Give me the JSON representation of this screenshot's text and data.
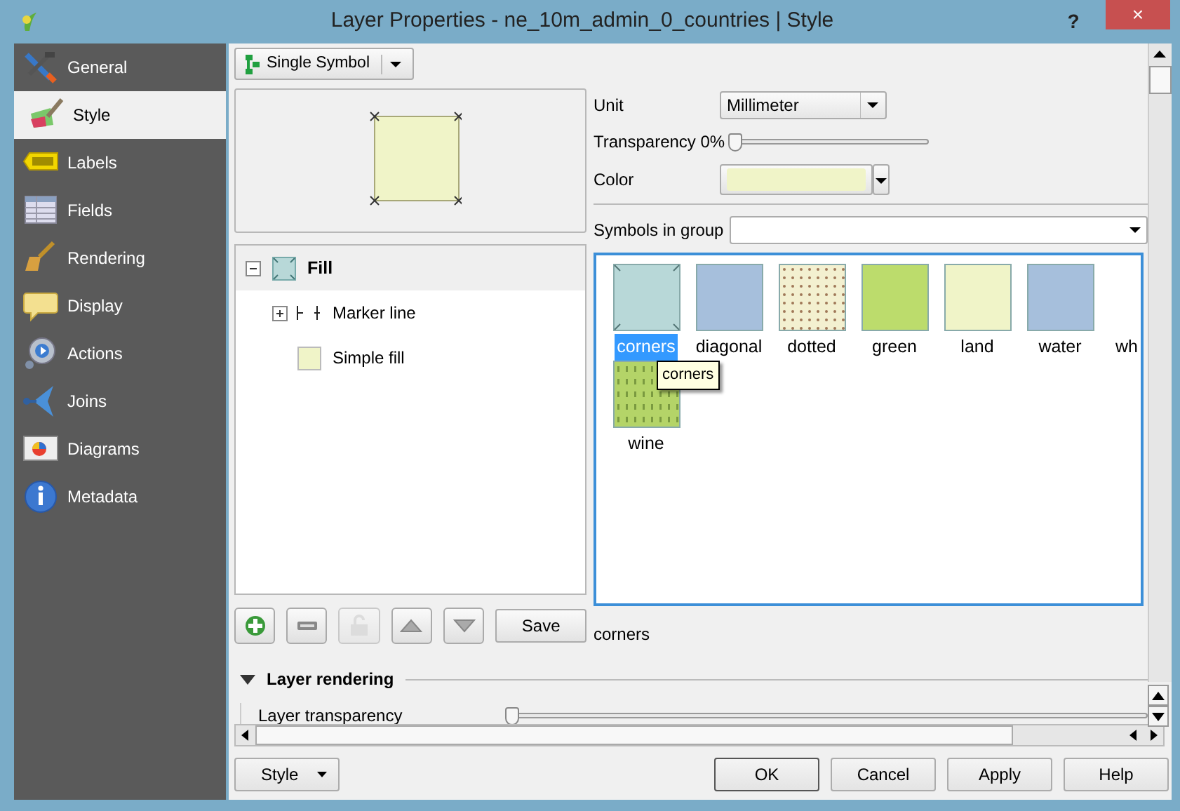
{
  "window": {
    "title": "Layer Properties - ne_10m_admin_0_countries | Style",
    "help_glyph": "?",
    "close_glyph": "×"
  },
  "sidebar": {
    "items": [
      {
        "label": "General",
        "kind": "tools",
        "selected": false
      },
      {
        "label": "Style",
        "kind": "brush",
        "selected": true
      },
      {
        "label": "Labels",
        "kind": "abc",
        "selected": false
      },
      {
        "label": "Fields",
        "kind": "table",
        "selected": false
      },
      {
        "label": "Rendering",
        "kind": "broom",
        "selected": false
      },
      {
        "label": "Display",
        "kind": "bubble",
        "selected": false
      },
      {
        "label": "Actions",
        "kind": "gear",
        "selected": false
      },
      {
        "label": "Joins",
        "kind": "join",
        "selected": false
      },
      {
        "label": "Diagrams",
        "kind": "diagram",
        "selected": false
      },
      {
        "label": "Metadata",
        "kind": "info",
        "selected": false
      }
    ]
  },
  "renderer": {
    "label": "Single Symbol"
  },
  "symbol_tree": {
    "label": "Fill",
    "expanded": true,
    "children": [
      {
        "label": "Marker line",
        "kind": "marker",
        "expanded": false
      },
      {
        "label": "Simple fill",
        "kind": "fill"
      }
    ]
  },
  "tree_tools": [
    {
      "kind": "add",
      "disabled": false
    },
    {
      "kind": "remove",
      "disabled": false
    },
    {
      "kind": "lock",
      "disabled": true
    },
    {
      "kind": "up",
      "disabled": false
    },
    {
      "kind": "down",
      "disabled": false
    }
  ],
  "save_button": "Save",
  "unit": {
    "label": "Unit",
    "value": "Millimeter"
  },
  "transparency": {
    "label": "Transparency 0%",
    "level": 0
  },
  "color": {
    "label": "Color",
    "color": "#f0f4c8"
  },
  "symbols_in_group": {
    "label": "Symbols in group"
  },
  "symbols": [
    {
      "name": "corners",
      "kind": "corners",
      "color": "#b8d8d8",
      "selected": true
    },
    {
      "name": "diagonal",
      "kind": "plain",
      "color": "#a6bfdc",
      "selected": false
    },
    {
      "name": "dotted",
      "kind": "dotted",
      "color": "#f3f0d0",
      "selected": false
    },
    {
      "name": "green",
      "kind": "plain",
      "color": "#bcdc6c",
      "selected": false
    },
    {
      "name": "land",
      "kind": "plain",
      "color": "#f0f4c8",
      "selected": false
    },
    {
      "name": "water",
      "kind": "plain",
      "color": "#a6bfdc",
      "selected": false
    },
    {
      "name": "wh",
      "kind": "blank",
      "selected": false
    },
    {
      "name": "wine",
      "kind": "dashes",
      "color": "#b4d468",
      "selected": false
    }
  ],
  "tooltip": "corners",
  "selected_symbol_name": "corners",
  "layer_rendering": {
    "title": "Layer rendering",
    "expanded": true,
    "transparency_label": "Layer transparency",
    "level": 0
  },
  "footer": {
    "style_button": "Style",
    "buttons": [
      "OK",
      "Cancel",
      "Apply",
      "Help"
    ]
  }
}
